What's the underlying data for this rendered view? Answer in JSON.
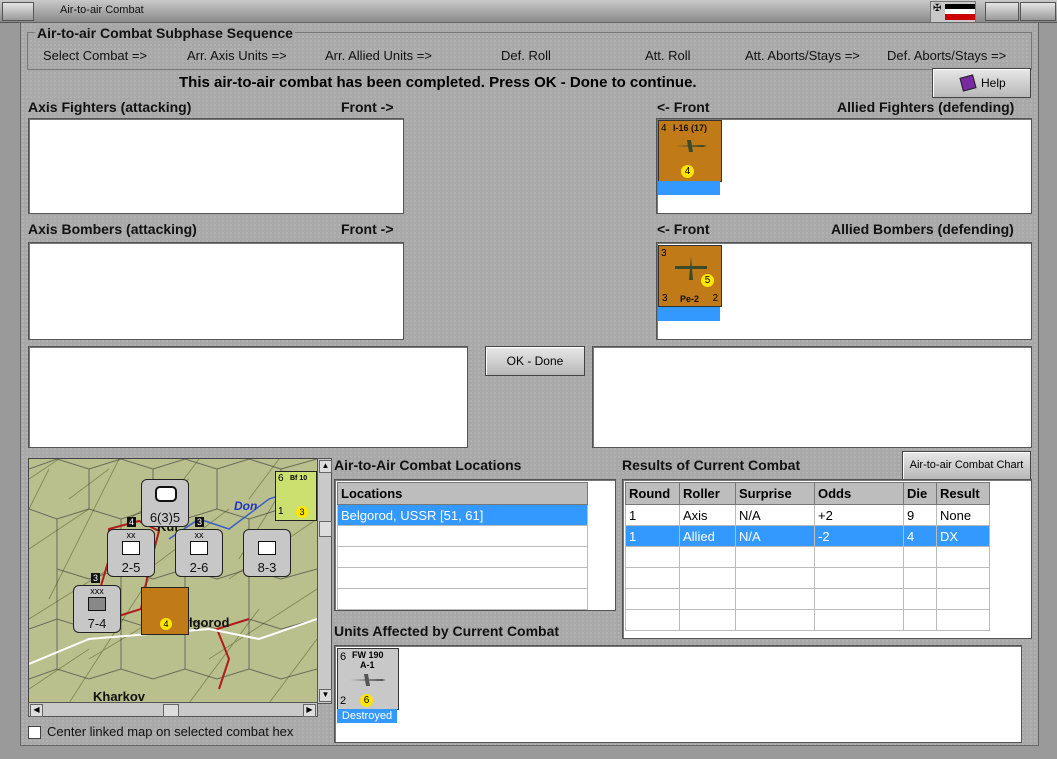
{
  "window": {
    "title": "Air-to-air Combat"
  },
  "sequence": {
    "title": "Air-to-air Combat Subphase Sequence",
    "steps": [
      "Select Combat =>",
      "Arr. Axis Units =>",
      "Arr. Allied Units =>",
      "Def. Roll",
      "Att. Roll",
      "Att. Aborts/Stays =>",
      "Def. Aborts/Stays =>"
    ]
  },
  "message": "This air-to-air combat has been completed.  Press OK - Done to continue.",
  "help_label": "Help",
  "axis_fighters": {
    "label": "Axis Fighters (attacking)",
    "front": "Front ->"
  },
  "allied_fighters": {
    "label": "Allied Fighters (defending)",
    "front": "<- Front",
    "counter": {
      "name": "I-16 (17)",
      "top_left": "4",
      "circle": "4"
    }
  },
  "axis_bombers": {
    "label": "Axis Bombers (attacking)",
    "front": "Front ->"
  },
  "allied_bombers": {
    "label": "Allied Bombers (defending)",
    "front": "<- Front",
    "counter": {
      "name": "Pe-2",
      "top_left": "3",
      "bottom_left": "3",
      "bottom_right": "2",
      "circle": "5"
    }
  },
  "ok_done_label": "OK - Done",
  "locations": {
    "title": "Air-to-Air Combat Locations",
    "header": "Locations",
    "rows": [
      "Belgorod, USSR [51, 61]"
    ]
  },
  "results": {
    "title": "Results of Current Combat",
    "chart_button": "Air-to-air Combat Chart",
    "headers": [
      "Round",
      "Roller",
      "Surprise",
      "Odds",
      "Die",
      "Result"
    ],
    "rows": [
      [
        "1",
        "Axis",
        "N/A",
        "+2",
        "9",
        "None"
      ],
      [
        "1",
        "Allied",
        "N/A",
        "-2",
        "4",
        "DX"
      ]
    ]
  },
  "affected": {
    "title": "Units Affected by Current Combat",
    "counter": {
      "name": "FW 190",
      "sub": "A-1",
      "top_left": "6",
      "bottom_left": "2",
      "circle": "6",
      "status": "Destroyed"
    }
  },
  "map": {
    "labels": {
      "don": "Don",
      "kursk": "Kur",
      "belgorod": "lgorod",
      "kharkov": "Kharkov"
    },
    "units": [
      {
        "top": "",
        "value": "6(3)5"
      },
      {
        "top": "xx",
        "value": "2-5"
      },
      {
        "top": "xx",
        "value": "2-6"
      },
      {
        "top": "",
        "value": "8-3"
      },
      {
        "top": "xxx",
        "value": "7-4"
      }
    ],
    "stack_bf": "Bf 10",
    "stack_bf_nums": [
      "6",
      "1",
      "3"
    ],
    "hex_numbers": [
      "4",
      "3",
      "3",
      "4"
    ]
  },
  "center_checkbox_label": "Center linked map on selected combat hex"
}
